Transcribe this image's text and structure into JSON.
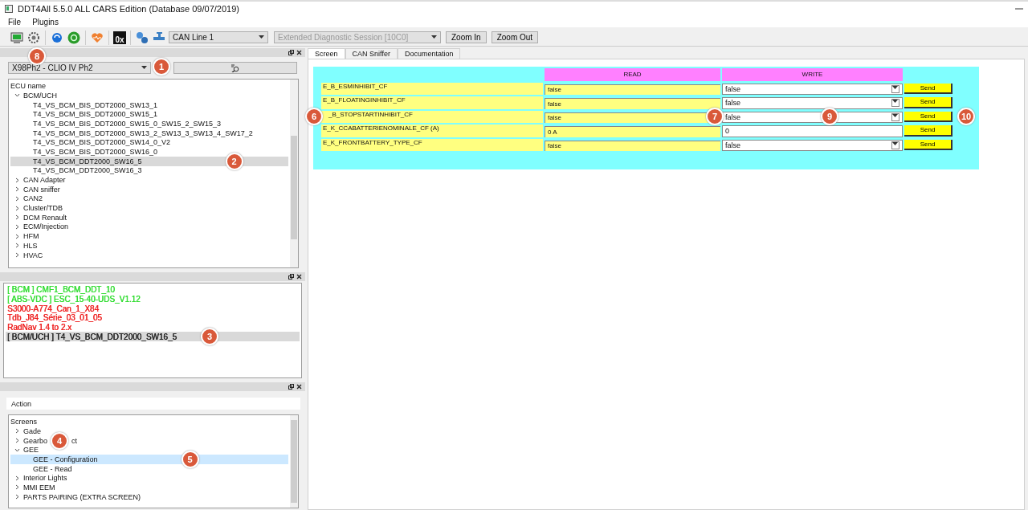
{
  "window": {
    "title": "DDT4All 5.5.0 ALL CARS Edition (Database 09/07/2019)"
  },
  "menu": [
    "File",
    "Plugins"
  ],
  "toolbar": {
    "hex_label": "0x",
    "can_line": "CAN Line 1",
    "session": {
      "value": "Extended Diagnostic Session [10C0]",
      "disabled": true
    },
    "buttons": [
      "Zoom In",
      "Zoom Out"
    ]
  },
  "ecu_dock": {
    "callout": "8",
    "vehicle": {
      "value": "X98Ph2 - CLIO IV Ph2",
      "callout": "1"
    },
    "header": "ECU name",
    "tree": [
      {
        "label": "BCM/UCH",
        "expanded": true,
        "selected": false,
        "children": [
          {
            "label": "T4_VS_BCM_BIS_DDT2000_SW13_1",
            "selected": false
          },
          {
            "label": "T4_VS_BCM_BIS_DDT2000_SW15_1",
            "selected": false
          },
          {
            "label": "T4_VS_BCM_BIS_DDT2000_SW15_0_SW15_2_SW15_3",
            "selected": false
          },
          {
            "label": "T4_VS_BCM_BIS_DDT2000_SW13_2_SW13_3_SW13_4_SW17_2",
            "selected": false
          },
          {
            "label": "T4_VS_BCM_BIS_DDT2000_SW14_0_V2",
            "selected": false
          },
          {
            "label": "T4_VS_BCM_BIS_DDT2000_SW16_0",
            "selected": false
          },
          {
            "label": "T4_VS_BCM_DDT2000_SW16_5",
            "selected": true,
            "callout": "2"
          },
          {
            "label": "T4_VS_BCM_DDT2000_SW16_3",
            "selected": false
          }
        ]
      },
      {
        "label": "CAN Adapter",
        "expanded": false,
        "selected": false
      },
      {
        "label": "CAN sniffer",
        "expanded": false,
        "selected": false
      },
      {
        "label": "CAN2",
        "expanded": false,
        "selected": false
      },
      {
        "label": "Cluster/TDB",
        "expanded": false,
        "selected": false
      },
      {
        "label": "DCM Renault",
        "expanded": false,
        "selected": false
      },
      {
        "label": "ECM/Injection",
        "expanded": false,
        "selected": false
      },
      {
        "label": "HFM",
        "expanded": false,
        "selected": false
      },
      {
        "label": "HLS",
        "expanded": false,
        "selected": false
      },
      {
        "label": "HVAC",
        "expanded": false,
        "selected": false
      }
    ]
  },
  "ecu_list": [
    {
      "label": "[ BCM ] CMF1_BCM_DDT_10",
      "color": "#33dd33",
      "selected": false
    },
    {
      "label": "[ ABS-VDC ] ESC_15-40-UDS_V1.12",
      "color": "#33dd33",
      "selected": false
    },
    {
      "label": "S3000-A774_Can_1_X84",
      "color": "#ee2222",
      "selected": false
    },
    {
      "label": "Tdb_J84_Série_03_01_05",
      "color": "#ee2222",
      "selected": false
    },
    {
      "label": "RadNav 1.4 to 2.x",
      "color": "#ee2222",
      "selected": false
    },
    {
      "label": "[ BCM/UCH ] T4_VS_BCM_DDT2000_SW16_5",
      "color": "#222222",
      "selected": true,
      "callout": "3"
    }
  ],
  "screens_dock": {
    "action": "Action",
    "header": "Screens",
    "tree": [
      {
        "label": "Gade",
        "expanded": false,
        "selected": false
      },
      {
        "label": "Gearbo",
        "label_tail": "ct",
        "callout": "4",
        "expanded": false,
        "selected": false
      },
      {
        "label": "GEE",
        "expanded": true,
        "selected": false,
        "children": [
          {
            "label": "GEE - Configuration",
            "selected": true,
            "callout": "5"
          },
          {
            "label": "GEE - Read",
            "selected": false
          }
        ]
      },
      {
        "label": "Interior Lights",
        "expanded": false,
        "selected": false
      },
      {
        "label": "MMI EEM",
        "expanded": false,
        "selected": false
      },
      {
        "label": "PARTS PAIRING (EXTRA SCREEN)",
        "expanded": false,
        "selected": false
      }
    ]
  },
  "tabs": [
    {
      "label": "Screen",
      "selected": true
    },
    {
      "label": "CAN Sniffer",
      "selected": false
    },
    {
      "label": "Documentation",
      "selected": false
    }
  ],
  "screen": {
    "read_header": "READ",
    "write_header": "WRITE",
    "rows": [
      {
        "label": "E_B_ESMINHIBIT_CF",
        "read": "false",
        "kind": "combo",
        "write": "false",
        "send": "Send"
      },
      {
        "label": "E_B_FLOATINGINHIBIT_CF",
        "read": "false",
        "kind": "combo",
        "write": "false",
        "send": "Send"
      },
      {
        "label": "_B_STOPSTARTINHIBIT_CF",
        "read": "false",
        "kind": "combo",
        "write": "false",
        "send": "Send",
        "label_callout": "6",
        "read_callout": "7",
        "write_callout": "9",
        "send_callout": "10"
      },
      {
        "label": "E_K_CCABATTERIENOMINALE_CF (A)",
        "read": "0 A",
        "kind": "input",
        "write": "0",
        "send": "Send"
      },
      {
        "label": "E_K_FRONTBATTERY_TYPE_CF",
        "read": "false",
        "kind": "combo",
        "write": "false",
        "send": "Send"
      }
    ]
  }
}
